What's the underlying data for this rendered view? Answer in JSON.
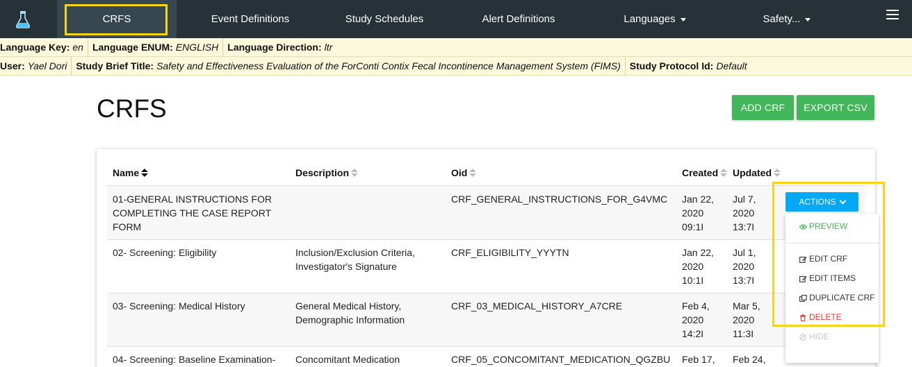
{
  "nav": {
    "items": [
      {
        "label": "CRFS"
      },
      {
        "label": "Event Definitions"
      },
      {
        "label": "Study Schedules"
      },
      {
        "label": "Alert Definitions"
      },
      {
        "label": "Languages"
      },
      {
        "label": "Safety..."
      }
    ]
  },
  "info": {
    "language_key_label": "Language Key:",
    "language_key": "en",
    "language_enum_label": "Language ENUM:",
    "language_enum": "ENGLISH",
    "language_direction_label": "Language Direction:",
    "language_direction": "ltr",
    "user_label": "User:",
    "user": "Yael Dori",
    "study_title_label": "Study Brief Title:",
    "study_title": "Safety and Effectiveness Evaluation of the ForConti Contix Fecal Incontinence Management System (FIMS)",
    "protocol_label": "Study Protocol Id:",
    "protocol": "Default"
  },
  "page": {
    "title": "CRFS",
    "add_button": "ADD CRF",
    "export_button": "EXPORT CSV"
  },
  "table": {
    "headers": {
      "name": "Name",
      "description": "Description",
      "oid": "Oid",
      "created": "Created",
      "updated": "Updated"
    },
    "rows": [
      {
        "name": [
          "01-GENERAL INSTRUCTIONS FOR",
          "COMPLETING THE CASE REPORT",
          "FORM"
        ],
        "description": [],
        "oid": "CRF_GENERAL_INSTRUCTIONS_FOR_G4VMC",
        "created": [
          "Jan 22,",
          "2020",
          "09:1I"
        ],
        "updated": [
          "Jul 7,",
          "2020",
          "13:7I"
        ]
      },
      {
        "name": [
          "02- Screening: Eligibility"
        ],
        "description": [
          "Inclusion/Exclusion Criteria,",
          "Investigator's Signature"
        ],
        "oid": "CRF_ELIGIBILITY_YYYTN",
        "created": [
          "Jan 22,",
          "2020",
          "10:1I"
        ],
        "updated": [
          "Jul 1,",
          "2020",
          "13:7I"
        ]
      },
      {
        "name": [
          "03- Screening: Medical History"
        ],
        "description": [
          "General Medical History,",
          "Demographic Information"
        ],
        "oid": "CRF_03_MEDICAL_HISTORY_A7CRE",
        "created": [
          "Feb 4,",
          "2020",
          "14:2I"
        ],
        "updated": [
          "Mar 5,",
          "2020",
          "11:3I"
        ]
      },
      {
        "name": [
          "04- Screening: Baseline Examination-"
        ],
        "description": [
          "Concomitant Medication"
        ],
        "oid": "CRF_05_CONCOMITANT_MEDICATION_QGZBU",
        "created": [
          "Feb 17,"
        ],
        "updated": [
          "Feb 24,"
        ]
      }
    ],
    "actions_label": "ACTIONS"
  },
  "dropdown": {
    "preview": "PREVIEW",
    "edit_crf": "EDIT CRF",
    "edit_items": "EDIT ITEMS",
    "duplicate_crf": "DUPLICATE CRF",
    "delete": "DELETE",
    "hide": "HIDE"
  },
  "colors": {
    "navbar": "#263238",
    "accent_green": "#43b55a",
    "accent_blue": "#03a9f4",
    "highlight": "#f7d417",
    "infobar": "#fbf8dc"
  }
}
